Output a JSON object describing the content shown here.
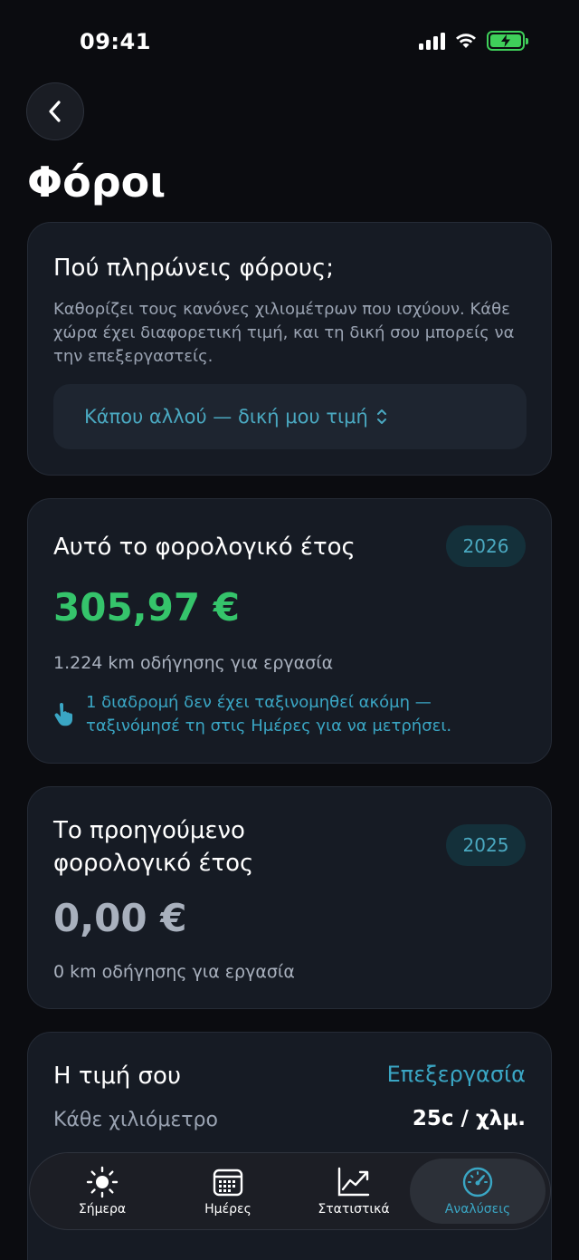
{
  "status": {
    "time": "09:41"
  },
  "page": {
    "title": "Φόροι"
  },
  "tax_country": {
    "title": "Πού πληρώνεις φόρους;",
    "description": "Καθορίζει τους κανόνες χιλιομέτρων που ισχύουν. Κάθε χώρα έχει διαφορετική τιμή, και τη δική σου μπορείς να την επεξεργαστείς.",
    "selected": "Κάπου αλλού — δική μου τιμή"
  },
  "current_year": {
    "title": "Αυτό το φορολογικό έτος",
    "year": "2026",
    "amount": "305,97 €",
    "km": "1.224 km οδήγησης για εργασία",
    "hint": "1 διαδρομή δεν έχει ταξινομηθεί ακόμη — ταξινόμησέ τη στις Ημέρες για να μετρήσει."
  },
  "previous_year": {
    "title_line1": "Το προηγούμενο",
    "title_line2": "φορολογικό έτος",
    "year": "2025",
    "amount": "0,00 €",
    "km": "0 km οδήγησης για εργασία"
  },
  "rate": {
    "title": "Η τιμή σου",
    "edit_label": "Επεξεργασία",
    "row_label": "Κάθε χιλιόμετρο",
    "row_value": "25c / χλμ."
  },
  "tabs": [
    {
      "label": "Σήμερα",
      "icon": "sun-icon"
    },
    {
      "label": "Ημέρες",
      "icon": "calendar-icon"
    },
    {
      "label": "Στατιστικά",
      "icon": "chart-icon"
    },
    {
      "label": "Αναλύσεις",
      "icon": "gauge-icon",
      "active": true
    }
  ],
  "colors": {
    "accent": "#3aa6c4",
    "positive": "#35c46b",
    "muted_amount": "#a8b0bd",
    "background": "#0b0c10",
    "card": "#161b24"
  }
}
